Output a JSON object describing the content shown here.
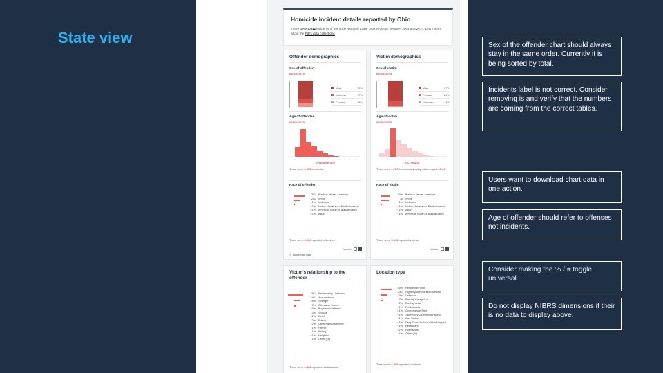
{
  "slide": {
    "title": "State view"
  },
  "header": {
    "title": "Homicide incident details reported by Ohio",
    "desc_prefix": "There were",
    "desc_count": "4,612",
    "desc_mid": "incidents of homicide reported to the UCR Program between 2004 and 2014. Learn more about the",
    "desc_link": "FBI's data collections"
  },
  "offender": {
    "title": "Offender demographics",
    "sex_title": "Sex of offender",
    "sex_cap": "INCIDENTS",
    "sex_legend": [
      {
        "label": "Male",
        "value": "73%",
        "color": "#b5403c"
      },
      {
        "label": "Unknown",
        "value": "17%",
        "color": "#d9534f"
      },
      {
        "label": "Female",
        "value": "10%",
        "color": "#f0908c"
      }
    ],
    "age_title": "Age of offender",
    "age_cap": "INCIDENTS",
    "age_axis": "OFFENDER AGE",
    "age_note_prefix": "There were",
    "age_note_count": "2,678",
    "age_note_suffix": "incidents.",
    "race_title": "Race of offender",
    "race_rows": [
      {
        "value": "3k1",
        "label": "Black or African American"
      },
      {
        "value": "2k1",
        "label": "White"
      },
      {
        "value": "1%",
        "label": "Unknown"
      },
      {
        "value": "<1%",
        "label": "Native Hawaiian or Pacific Islander"
      },
      {
        "value": "<1%",
        "label": "American Indian or Alaska Native"
      },
      {
        "value": "<1%",
        "label": "Asian"
      }
    ],
    "race_note_prefix": "There were",
    "race_note_count": "4,612",
    "race_note_suffix": "reported offenders.",
    "view_by": "View by",
    "download": "Download data"
  },
  "victim": {
    "title": "Victim demographics",
    "sex_title": "Sex of victim",
    "sex_cap": "INCIDENTS",
    "sex_legend": [
      {
        "label": "Male",
        "value": "77%",
        "color": "#b5403c"
      },
      {
        "label": "Female",
        "value": "21%",
        "color": "#d9534f"
      },
      {
        "label": "Unknown",
        "value": "1%",
        "color": "#f0908c"
      }
    ],
    "age_title": "Age of victim",
    "age_cap": "INCIDENTS",
    "age_axis": "VICTIM AGE",
    "age_note_prefix": "There were",
    "age_note_count": "1,707",
    "age_note_suffix": "incidents involving victims aged",
    "age_note_range": "20-29.",
    "race_title": "Race of victim",
    "race_rows": [
      {
        "value": "45%",
        "label": "Black or African American"
      },
      {
        "value": "3k",
        "label": "White"
      },
      {
        "value": "1%",
        "label": "Unknown"
      },
      {
        "value": "<1%",
        "label": "Native Hawaiian or Pacific Islander"
      },
      {
        "value": "<1%",
        "label": "Asian"
      },
      {
        "value": "<1%",
        "label": "American Indian or Alaska Native"
      }
    ],
    "race_note_prefix": "There were",
    "race_note_count": "5,134",
    "race_note_suffix": "reported victims.",
    "view_by": "View by"
  },
  "relationship": {
    "title": "Victim's relationship to the offender",
    "rows": [
      {
        "value": "3k1",
        "label": "Relationship Unknown"
      },
      {
        "value": "1%1",
        "label": "Acquaintance"
      },
      {
        "value": "8%",
        "label": "Stranger"
      },
      {
        "value": "5%",
        "label": "Otherwise Known"
      },
      {
        "value": "5%",
        "label": "Boyfriend/Girlfriend"
      },
      {
        "value": "3%",
        "label": "Spouse"
      },
      {
        "value": "2%",
        "label": "Child"
      },
      {
        "value": "2%",
        "label": "Friend"
      },
      {
        "value": "2%",
        "label": "Other Family Member"
      },
      {
        "value": "1%",
        "label": "Parent"
      },
      {
        "value": "1%",
        "label": "Sibling"
      },
      {
        "value": "<1%",
        "label": "Neighbor"
      },
      {
        "value": "1%",
        "label": "Other (16)"
      }
    ],
    "note_prefix": "There were",
    "note_count": "4,484",
    "note_suffix": "reported relationships."
  },
  "location": {
    "title": "Location type",
    "rows": [
      {
        "value": "48%",
        "label": "Residence/Home"
      },
      {
        "value": "2k1",
        "label": "Highway/Alley/Street/Sidewalk"
      },
      {
        "value": "13%",
        "label": "Unknown"
      },
      {
        "value": "7%",
        "label": "Parking Garage/Lot"
      },
      {
        "value": "2%",
        "label": "Bar/Nightclub"
      },
      {
        "value": "1%",
        "label": "Field/Woods"
      },
      {
        "value": "<1%",
        "label": "Convenience Store"
      },
      {
        "value": "<1%",
        "label": "Jail/Prison/Corrections Facility"
      },
      {
        "value": "<1%",
        "label": "Gas Station"
      },
      {
        "value": "<1%",
        "label": "Drug Store/Doctor's Office/Hospital"
      },
      {
        "value": "<1%",
        "label": "Restaurant"
      },
      {
        "value": "<1%",
        "label": "Hotel/Motel"
      },
      {
        "value": "1%",
        "label": "Other (24)"
      }
    ],
    "note_prefix": "There were",
    "note_count": "4,580",
    "note_suffix": "reported locations."
  },
  "comments": [
    "Sex of the offender chart should always stay in the same order. Currently it is being sorted by total.",
    "Incidents label is not correct. Consider removing is and verify that the numbers are coming from the correct tables.",
    "Users want to download chart data in one action.",
    "Age of offender should refer to offenses not incidents.",
    "Consider making the % / # toggle universal.",
    "Do not display NIBRS dimensions if their is no data to display above."
  ]
}
